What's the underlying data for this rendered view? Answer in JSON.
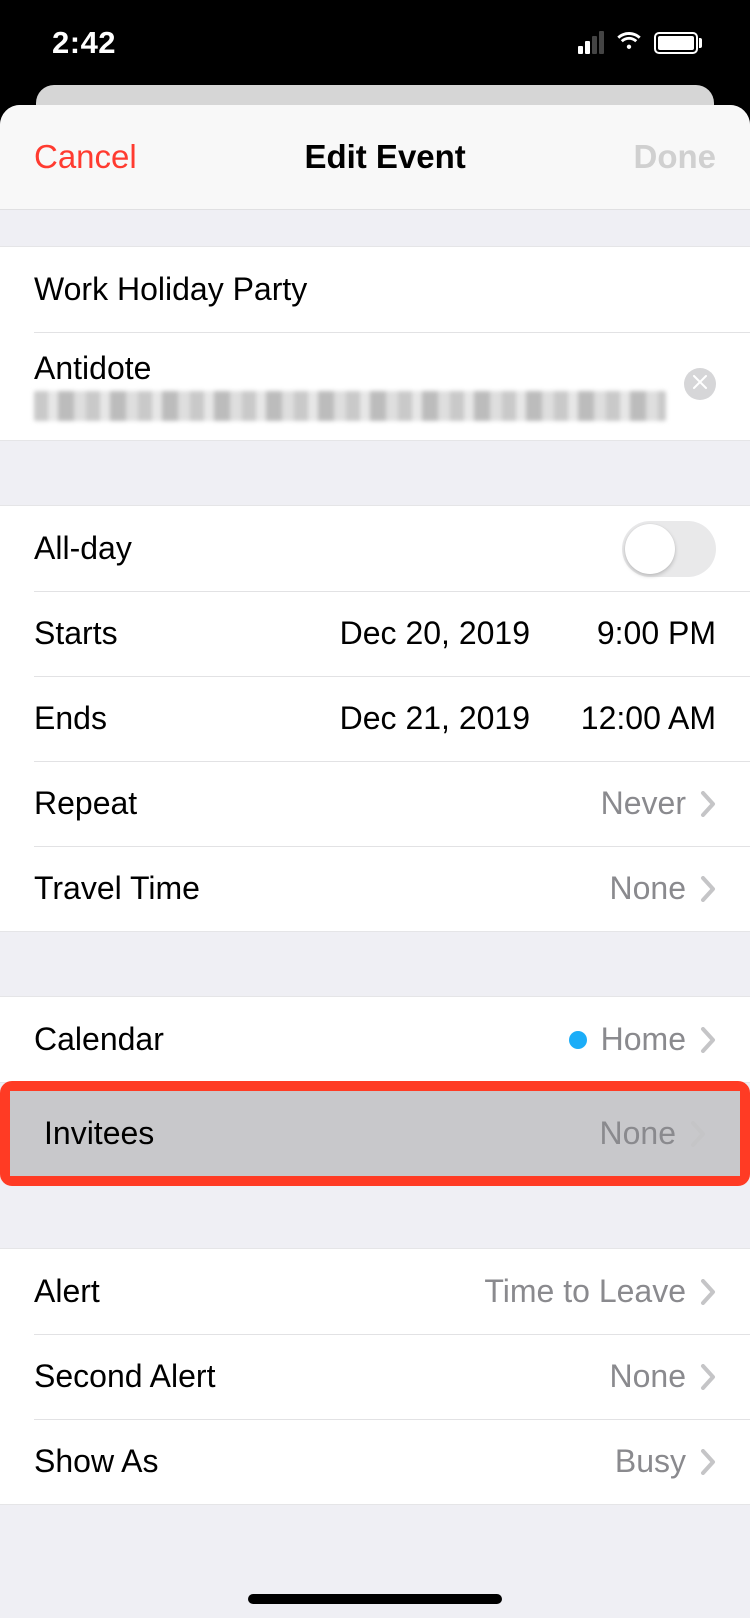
{
  "status": {
    "time": "2:42"
  },
  "nav": {
    "cancel": "Cancel",
    "title": "Edit Event",
    "done": "Done"
  },
  "event": {
    "title": "Work Holiday Party",
    "location_name": "Antidote"
  },
  "rows": {
    "all_day": "All-day",
    "starts": {
      "label": "Starts",
      "date": "Dec 20, 2019",
      "time": "9:00 PM"
    },
    "ends": {
      "label": "Ends",
      "date": "Dec 21, 2019",
      "time": "12:00 AM"
    },
    "repeat": {
      "label": "Repeat",
      "value": "Never"
    },
    "travel": {
      "label": "Travel Time",
      "value": "None"
    },
    "calendar": {
      "label": "Calendar",
      "value": "Home"
    },
    "invitees": {
      "label": "Invitees",
      "value": "None"
    },
    "alert": {
      "label": "Alert",
      "value": "Time to Leave"
    },
    "second_alert": {
      "label": "Second Alert",
      "value": "None"
    },
    "show_as": {
      "label": "Show As",
      "value": "Busy"
    }
  }
}
